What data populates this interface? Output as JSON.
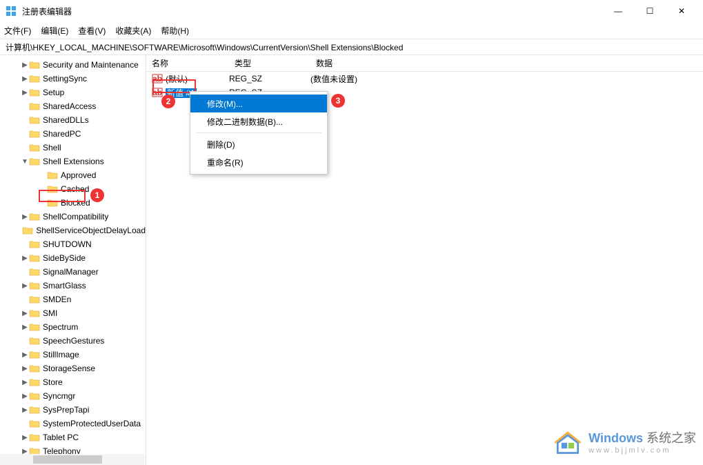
{
  "window": {
    "title": "注册表编辑器"
  },
  "winbtns": {
    "min": "—",
    "max": "☐",
    "close": "✕"
  },
  "menu": {
    "file": "文件(F)",
    "edit": "编辑(E)",
    "view": "查看(V)",
    "fav": "收藏夹(A)",
    "help": "帮助(H)"
  },
  "address": "计算机\\HKEY_LOCAL_MACHINE\\SOFTWARE\\Microsoft\\Windows\\CurrentVersion\\Shell Extensions\\Blocked",
  "tree": [
    {
      "l": "Security and Maintenance",
      "i": 30,
      "c": ">"
    },
    {
      "l": "SettingSync",
      "i": 30,
      "c": ">"
    },
    {
      "l": "Setup",
      "i": 30,
      "c": ">"
    },
    {
      "l": "SharedAccess",
      "i": 30,
      "c": ""
    },
    {
      "l": "SharedDLLs",
      "i": 30,
      "c": ""
    },
    {
      "l": "SharedPC",
      "i": 30,
      "c": ""
    },
    {
      "l": "Shell",
      "i": 30,
      "c": ""
    },
    {
      "l": "Shell Extensions",
      "i": 30,
      "c": "v"
    },
    {
      "l": "Approved",
      "i": 56,
      "c": ""
    },
    {
      "l": "Cached",
      "i": 56,
      "c": ""
    },
    {
      "l": "Blocked",
      "i": 56,
      "c": "",
      "hl": true
    },
    {
      "l": "ShellCompatibility",
      "i": 30,
      "c": ">"
    },
    {
      "l": "ShellServiceObjectDelayLoad",
      "i": 30,
      "c": ""
    },
    {
      "l": "SHUTDOWN",
      "i": 30,
      "c": ""
    },
    {
      "l": "SideBySide",
      "i": 30,
      "c": ">"
    },
    {
      "l": "SignalManager",
      "i": 30,
      "c": ""
    },
    {
      "l": "SmartGlass",
      "i": 30,
      "c": ">"
    },
    {
      "l": "SMDEn",
      "i": 30,
      "c": ""
    },
    {
      "l": "SMI",
      "i": 30,
      "c": ">"
    },
    {
      "l": "Spectrum",
      "i": 30,
      "c": ">"
    },
    {
      "l": "SpeechGestures",
      "i": 30,
      "c": ""
    },
    {
      "l": "StillImage",
      "i": 30,
      "c": ">"
    },
    {
      "l": "StorageSense",
      "i": 30,
      "c": ">"
    },
    {
      "l": "Store",
      "i": 30,
      "c": ">"
    },
    {
      "l": "Syncmgr",
      "i": 30,
      "c": ">"
    },
    {
      "l": "SysPrepTapi",
      "i": 30,
      "c": ">"
    },
    {
      "l": "SystemProtectedUserData",
      "i": 30,
      "c": ""
    },
    {
      "l": "Tablet PC",
      "i": 30,
      "c": ">"
    },
    {
      "l": "Telephony",
      "i": 30,
      "c": ">"
    }
  ],
  "cols": {
    "name": "名称",
    "type": "类型",
    "data": "数据"
  },
  "rows": [
    {
      "name": "(默认)",
      "type": "REG_SZ",
      "data": "(数值未设置)"
    },
    {
      "name": "新值 #1",
      "type": "REG_SZ",
      "data": "",
      "sel": true
    }
  ],
  "reg_icon_label": "ab",
  "context": {
    "m1": "修改(M)...",
    "m2": "修改二进制数据(B)...",
    "m3": "删除(D)",
    "m4": "重命名(R)"
  },
  "badges": {
    "b1": "1",
    "b2": "2",
    "b3": "3"
  },
  "watermark": {
    "t1a": "Windows",
    "t1b": " 系统之家",
    "t2": "www.bjjmlv.com"
  }
}
